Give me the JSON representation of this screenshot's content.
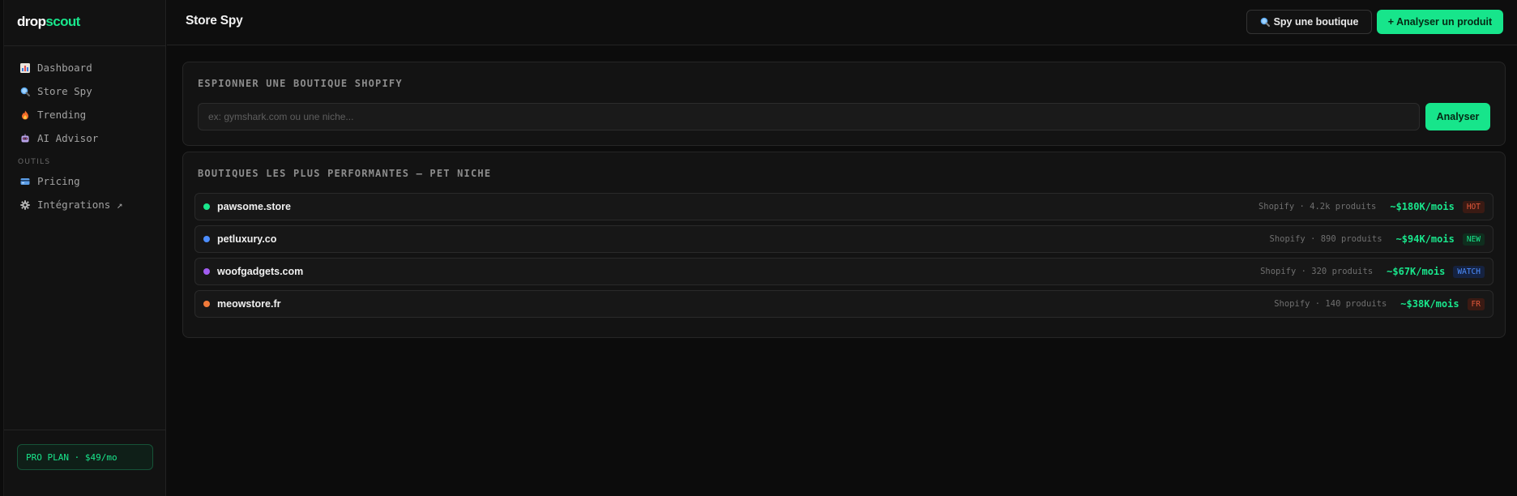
{
  "logo": {
    "part1": "drop",
    "part2": "scout"
  },
  "sidebar": {
    "items": [
      {
        "label": "Dashboard",
        "icon": "bar-chart-icon"
      },
      {
        "label": "Store Spy",
        "icon": "magnifier-icon"
      },
      {
        "label": "Trending",
        "icon": "fire-icon"
      },
      {
        "label": "AI Advisor",
        "icon": "robot-icon"
      }
    ],
    "section_label": "OUTILS",
    "tools": [
      {
        "label": "Pricing",
        "icon": "credit-card-icon"
      },
      {
        "label": "Intégrations ↗",
        "icon": "gear-icon"
      }
    ],
    "plan": "PRO PLAN · $49/mo"
  },
  "header": {
    "title": "Store Spy",
    "spy_button": "Spy une boutique",
    "spy_icon": "magnifier-icon",
    "analyze_button": "+ Analyser un produit"
  },
  "spy_card": {
    "title": "ESPIONNER UNE BOUTIQUE SHOPIFY",
    "placeholder": "ex: gymshark.com ou une niche...",
    "button": "Analyser"
  },
  "stores_card": {
    "title": "BOUTIQUES LES PLUS PERFORMANTES — PET NICHE",
    "rows": [
      {
        "name": "pawsome.store",
        "dot_color": "#19e68c",
        "meta": "Shopify · 4.2k produits",
        "revenue": "~$180K/mois",
        "badge": "HOT",
        "badge_color": "#e0573a",
        "badge_bg": "#3a1a13"
      },
      {
        "name": "petluxury.co",
        "dot_color": "#4c8dff",
        "meta": "Shopify · 890 produits",
        "revenue": "~$94K/mois",
        "badge": "NEW",
        "badge_color": "#19e68c",
        "badge_bg": "#0f2e1e"
      },
      {
        "name": "woofgadgets.com",
        "dot_color": "#a15cf0",
        "meta": "Shopify · 320 produits",
        "revenue": "~$67K/mois",
        "badge": "WATCH",
        "badge_color": "#4c8dff",
        "badge_bg": "#152240"
      },
      {
        "name": "meowstore.fr",
        "dot_color": "#f07a3a",
        "meta": "Shopify · 140 produits",
        "revenue": "~$38K/mois",
        "badge": "FR",
        "badge_color": "#e0573a",
        "badge_bg": "#3a1a13"
      }
    ]
  },
  "colors": {
    "accent": "#19e68c",
    "background": "#0c0c0c",
    "card": "#131313"
  }
}
